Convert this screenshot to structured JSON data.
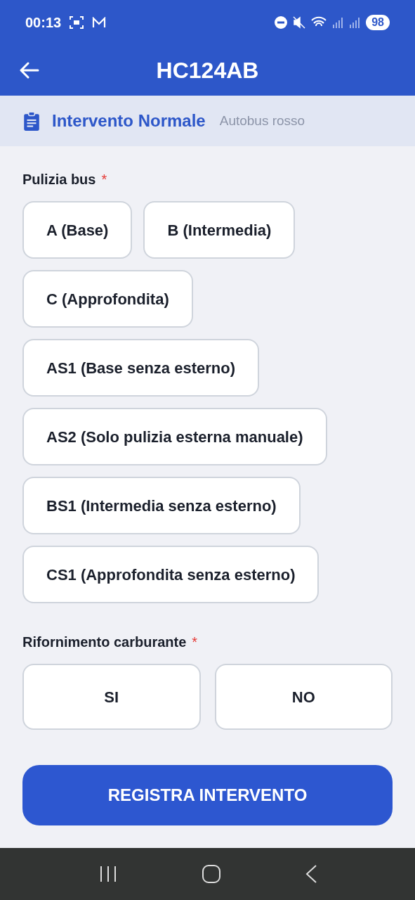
{
  "status_bar": {
    "time": "00:13",
    "battery": "98"
  },
  "header": {
    "title": "HC124AB"
  },
  "intervention": {
    "type": "Intervento Normale",
    "bus": "Autobus rosso"
  },
  "cleaning": {
    "label": "Pulizia bus",
    "required_mark": "*",
    "options": [
      {
        "label": "A (Base)",
        "selected": false
      },
      {
        "label": "B (Intermedia)",
        "selected": false
      },
      {
        "label": "C (Approfondita)",
        "selected": false
      },
      {
        "label": "AS1 (Base senza esterno)",
        "selected": false
      },
      {
        "label": "AS2 (Solo pulizia esterna manuale)",
        "selected": false
      },
      {
        "label": "BS1 (Intermedia senza esterno)",
        "selected": false
      },
      {
        "label": "CS1 (Approfondita senza esterno)",
        "selected": false
      }
    ]
  },
  "refuel": {
    "label": "Rifornimento carburante",
    "required_mark": "*",
    "options": [
      {
        "label": "SI",
        "selected": false
      },
      {
        "label": "NO",
        "selected": false
      }
    ]
  },
  "submit": {
    "label": "REGISTRA INTERVENTO"
  }
}
